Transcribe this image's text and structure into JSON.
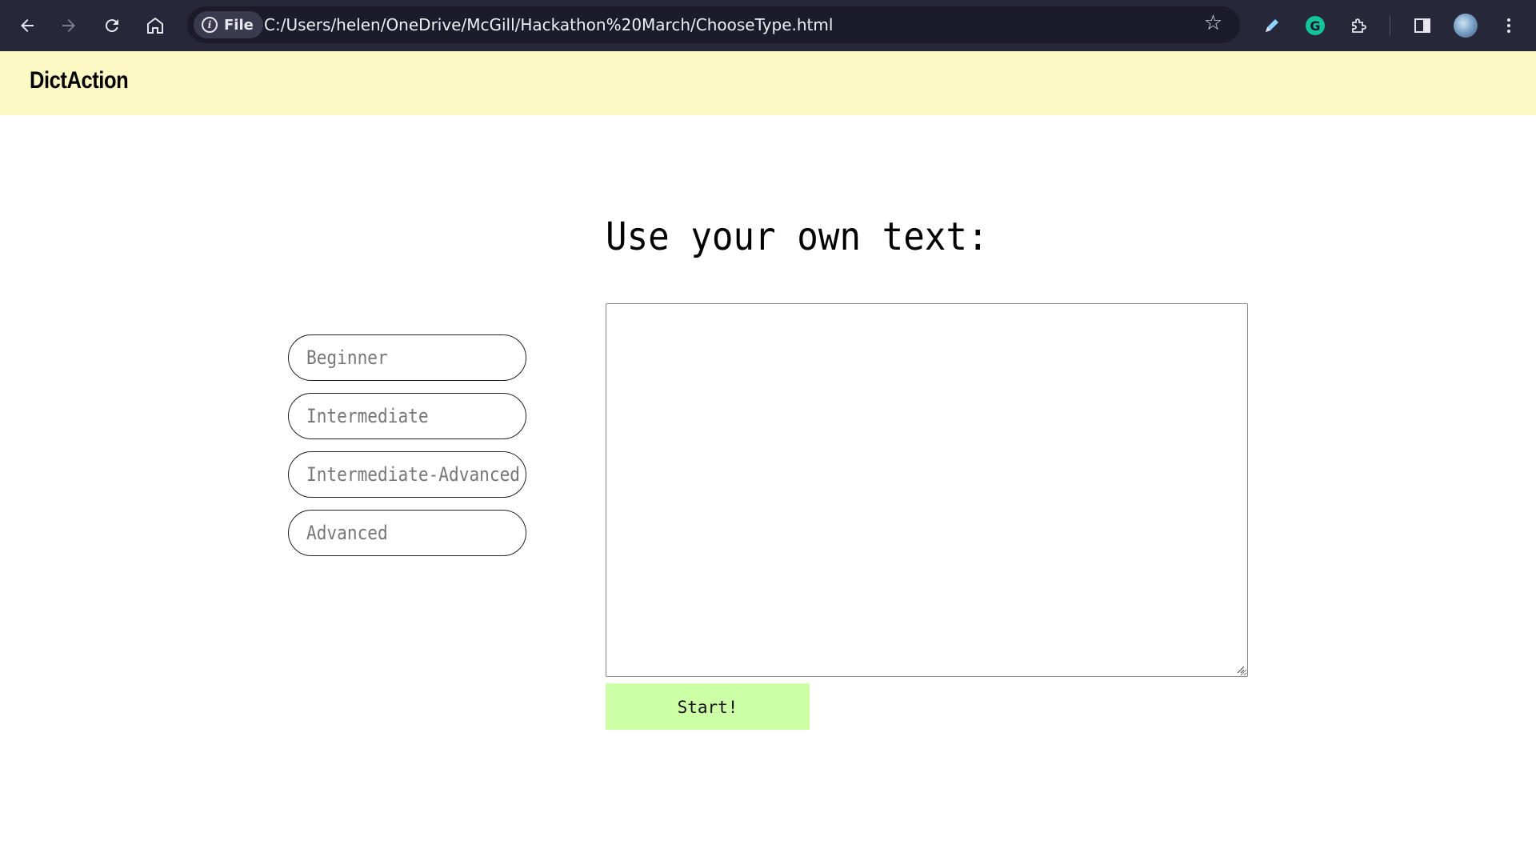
{
  "browser": {
    "site_chip_label": "File",
    "url": "C:/Users/helen/OneDrive/McGill/Hackathon%20March/ChooseType.html",
    "icons": {
      "back": "back-arrow-icon",
      "forward": "forward-arrow-icon",
      "reload": "reload-icon",
      "home": "home-icon",
      "info": "info-icon",
      "bookmark": "star-icon",
      "pen": "pen-icon",
      "grammarly": "grammarly-icon",
      "extensions": "puzzle-icon",
      "side_panel": "side-panel-icon",
      "profile": "avatar",
      "menu": "kebab-menu-icon"
    }
  },
  "header": {
    "brand": "DictAction",
    "background_color": "#fdf9c4"
  },
  "main": {
    "title": "Use your own text:",
    "levels": [
      {
        "label": "Beginner"
      },
      {
        "label": "Intermediate"
      },
      {
        "label": "Intermediate-Advanced"
      },
      {
        "label": "Advanced"
      }
    ],
    "textarea_value": "",
    "start_label": "Start!",
    "start_color": "#ccffa6"
  }
}
